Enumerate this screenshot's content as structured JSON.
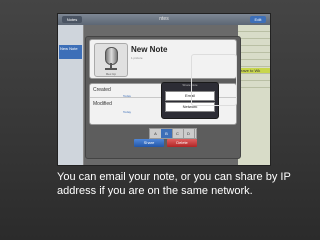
{
  "statusbar": {
    "title": "ntes",
    "left_btn": "Notes",
    "right_btn": "Edit"
  },
  "left_sidebar": {
    "selected_item": "New Note"
  },
  "right_sidebar": {
    "tag": "Leave to Wk"
  },
  "note": {
    "title": "New Note",
    "subtitle": "1 picture",
    "mic_label": "Rec Up"
  },
  "info": {
    "created_label": "Created",
    "created_value": "Today",
    "modified_label": "Modified",
    "modified_value": "Today"
  },
  "popover": {
    "title": "Share Note",
    "items": [
      "Email",
      "Network"
    ]
  },
  "toolbar": {
    "segments": [
      "A",
      "B",
      "C",
      "D"
    ]
  },
  "actions": {
    "share_label": "Share",
    "delete_label": "Delete"
  },
  "caption": {
    "text": "You can email your note, or you can share by IP address if you are on the same network."
  }
}
